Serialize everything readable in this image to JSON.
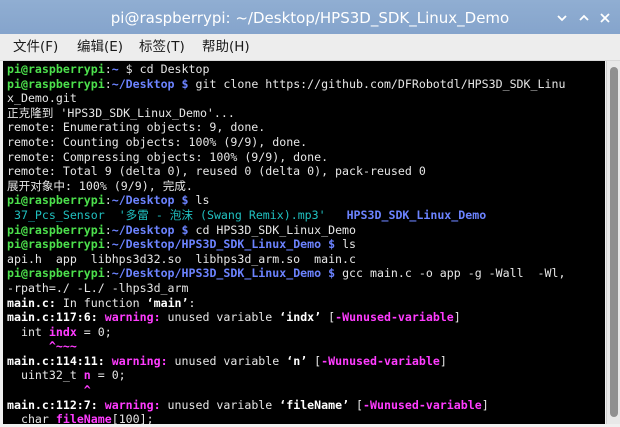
{
  "window": {
    "title": "pi@raspberrypi: ~/Desktop/HPS3D_SDK_Linux_Demo",
    "controls": [
      {
        "name": "minimize-button",
        "icon": "chevron-down-icon"
      },
      {
        "name": "maximize-button",
        "icon": "chevron-up-icon"
      },
      {
        "name": "close-button",
        "icon": "close-icon"
      }
    ]
  },
  "menu": {
    "items": [
      "文件(F)",
      "编辑(E)",
      "标签(T)",
      "帮助(H)"
    ]
  },
  "colors": {
    "prompt_user": "#4ce04c",
    "prompt_path": "#6c83ff",
    "directory": "#6c83ff",
    "file_colored": "#20c0c0",
    "warning": "#ff3cff",
    "caret": "#4ce04c",
    "terminal_bg": "#000000"
  },
  "terminal": {
    "lines": [
      [
        {
          "t": "pi@raspberrypi",
          "c": "g"
        },
        {
          "t": ":"
        },
        {
          "t": "~",
          "c": "b"
        },
        {
          "t": " $ cd Desktop"
        }
      ],
      [
        {
          "t": "pi@raspberrypi",
          "c": "g"
        },
        {
          "t": ":"
        },
        {
          "t": "~/Desktop $",
          "c": "b"
        },
        {
          "t": " git clone https://github.com/DFRobotdl/HPS3D_SDK_Linu"
        }
      ],
      [
        {
          "t": "x_Demo.git"
        }
      ],
      [
        {
          "t": "正克隆到 'HPS3D_SDK_Linux_Demo'..."
        }
      ],
      [
        {
          "t": "remote: Enumerating objects: 9, done."
        }
      ],
      [
        {
          "t": "remote: Counting objects: 100% (9/9), done."
        }
      ],
      [
        {
          "t": "remote: Compressing objects: 100% (9/9), done."
        }
      ],
      [
        {
          "t": "remote: Total 9 (delta 0), reused 0 (delta 0), pack-reused 0"
        }
      ],
      [
        {
          "t": "展开对象中: 100% (9/9), 完成."
        }
      ],
      [
        {
          "t": "pi@raspberrypi",
          "c": "g"
        },
        {
          "t": ":"
        },
        {
          "t": "~/Desktop $",
          "c": "b"
        },
        {
          "t": " ls"
        }
      ],
      [
        {
          "t": " "
        },
        {
          "t": "37_Pcs_Sensor",
          "c": "cy"
        },
        {
          "t": "  "
        },
        {
          "t": "'多雷 - 泡沫 (Swang Remix).mp3'",
          "c": "cy"
        },
        {
          "t": "   "
        },
        {
          "t": "HPS3D_SDK_Linux_Demo",
          "c": "b"
        }
      ],
      [
        {
          "t": "pi@raspberrypi",
          "c": "g"
        },
        {
          "t": ":"
        },
        {
          "t": "~/Desktop $",
          "c": "b"
        },
        {
          "t": " cd HPS3D_SDK_Linux_Demo"
        }
      ],
      [
        {
          "t": "pi@raspberrypi",
          "c": "g"
        },
        {
          "t": ":"
        },
        {
          "t": "~/Desktop/HPS3D_SDK_Linux_Demo $",
          "c": "b"
        },
        {
          "t": " ls"
        }
      ],
      [
        {
          "t": "api.h  app  libhps3d32.so  libhps3d_arm.so  main.c"
        }
      ],
      [
        {
          "t": "pi@raspberrypi",
          "c": "g"
        },
        {
          "t": ":"
        },
        {
          "t": "~/Desktop/HPS3D_SDK_Linux_Demo $",
          "c": "b"
        },
        {
          "t": " gcc main.c -o app -g -Wall  -Wl,"
        }
      ],
      [
        {
          "t": "-rpath=./ -L./ -lhps3d_arm"
        }
      ],
      [
        {
          "t": "main.c:",
          "c": "wh"
        },
        {
          "t": " In function "
        },
        {
          "t": "‘main’",
          "c": "wh"
        },
        {
          "t": ":"
        }
      ],
      [
        {
          "t": "main.c:117:6:",
          "c": "wh"
        },
        {
          "t": " "
        },
        {
          "t": "warning:",
          "c": "mg"
        },
        {
          "t": " unused variable "
        },
        {
          "t": "‘indx’",
          "c": "wh"
        },
        {
          "t": " ["
        },
        {
          "t": "-Wunused-variable",
          "c": "mg"
        },
        {
          "t": "]"
        }
      ],
      [
        {
          "t": "  int "
        },
        {
          "t": "indx",
          "c": "mg"
        },
        {
          "t": " = 0;"
        }
      ],
      [
        {
          "t": "      "
        },
        {
          "t": "^~~~",
          "c": "mg"
        }
      ],
      [
        {
          "t": "main.c:114:11:",
          "c": "wh"
        },
        {
          "t": " "
        },
        {
          "t": "warning:",
          "c": "mg"
        },
        {
          "t": " unused variable "
        },
        {
          "t": "‘n’",
          "c": "wh"
        },
        {
          "t": " ["
        },
        {
          "t": "-Wunused-variable",
          "c": "mg"
        },
        {
          "t": "]"
        }
      ],
      [
        {
          "t": "  uint32_t "
        },
        {
          "t": "n",
          "c": "mg"
        },
        {
          "t": " = 0;"
        }
      ],
      [
        {
          "t": "           "
        },
        {
          "t": "^",
          "c": "mg"
        }
      ],
      [
        {
          "t": "main.c:112:7:",
          "c": "wh"
        },
        {
          "t": " "
        },
        {
          "t": "warning:",
          "c": "mg"
        },
        {
          "t": " unused variable "
        },
        {
          "t": "‘fileName’",
          "c": "wh"
        },
        {
          "t": " ["
        },
        {
          "t": "-Wunused-variable",
          "c": "mg"
        },
        {
          "t": "]"
        }
      ],
      [
        {
          "t": "  char "
        },
        {
          "t": "fileName",
          "c": "mg"
        },
        {
          "t": "[100];"
        }
      ]
    ]
  }
}
